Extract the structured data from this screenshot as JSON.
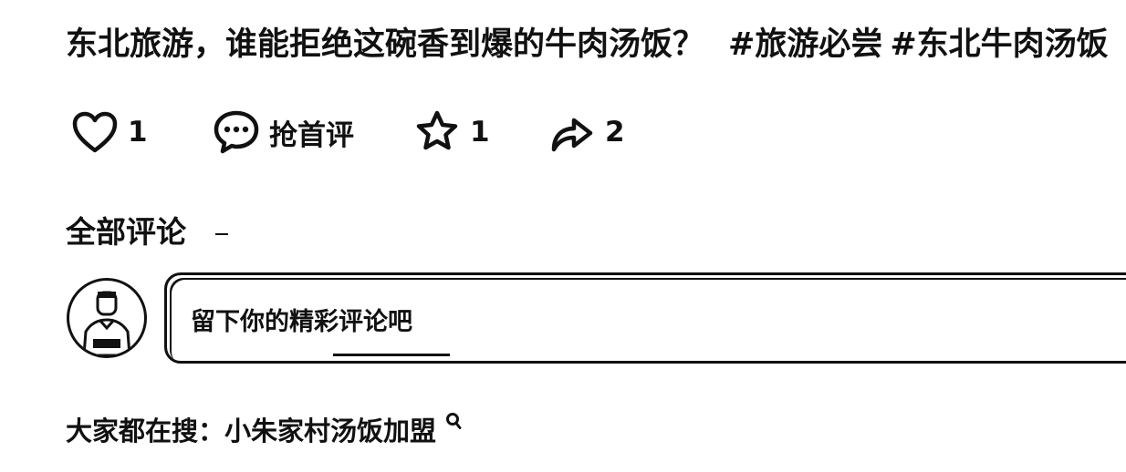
{
  "post": {
    "title": "东北旅游，谁能拒绝这碗香到爆的牛肉汤饭？",
    "hashtags": [
      "#旅游必尝",
      "#东北牛肉汤饭"
    ]
  },
  "actions": {
    "like": {
      "icon": "heart-icon",
      "count": "1"
    },
    "comment": {
      "icon": "comment-bubble-icon",
      "label": "抢首评"
    },
    "favorite": {
      "icon": "star-icon",
      "count": "1"
    },
    "share": {
      "icon": "share-arrow-icon",
      "count": "2"
    }
  },
  "comments": {
    "section_title": "全部评论",
    "input_placeholder": "留下你的精彩评论吧"
  },
  "hot_search": {
    "prefix": "大家都在搜：",
    "term": "小朱家村汤饭加盟",
    "icon": "search-icon"
  }
}
